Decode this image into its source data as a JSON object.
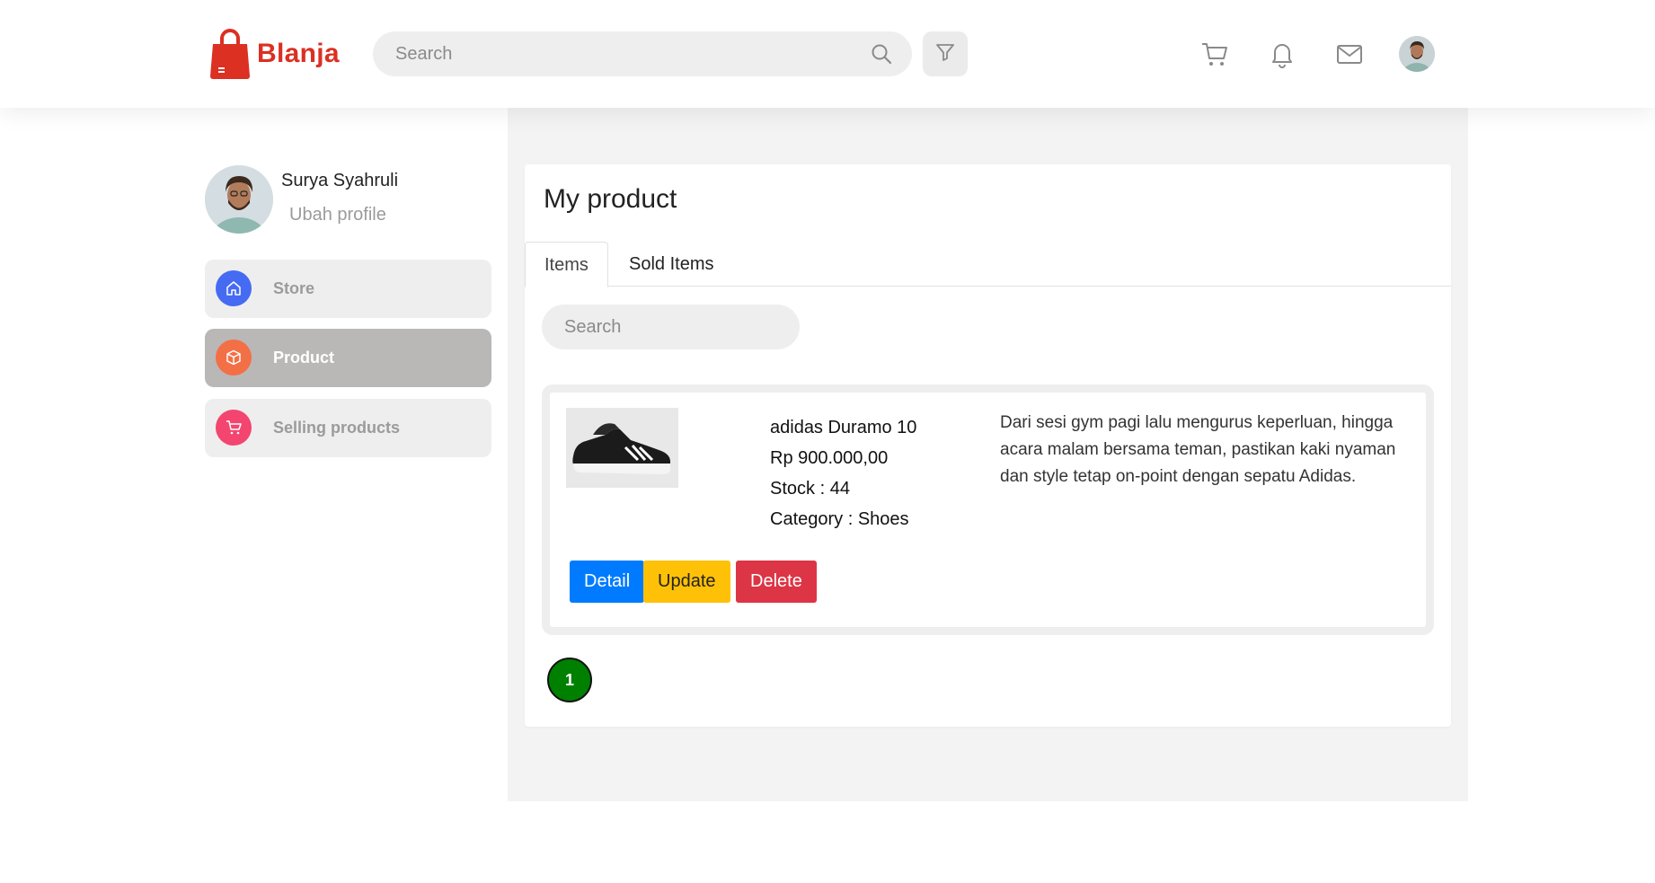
{
  "header": {
    "brand": "Blanja",
    "search_placeholder": "Search",
    "icons": [
      "cart-icon",
      "bell-icon",
      "mail-icon"
    ]
  },
  "sidebar": {
    "user_name": "Surya Syahruli",
    "edit_profile": "Ubah profile",
    "items": [
      {
        "label": "Store",
        "icon": "home-icon",
        "color": "#456bf3",
        "active": false
      },
      {
        "label": "Product",
        "icon": "box-icon",
        "color": "#f36f45",
        "active": true
      },
      {
        "label": "Selling products",
        "icon": "cart-icon",
        "color": "#f3456f",
        "active": false
      }
    ]
  },
  "main": {
    "title": "My product",
    "tabs": [
      {
        "label": "Items",
        "active": true
      },
      {
        "label": "Sold Items",
        "active": false
      }
    ],
    "search_placeholder": "Search",
    "product": {
      "name": "adidas Duramo 10",
      "price": "Rp 900.000,00",
      "stock": "Stock : 44",
      "category": "Category : Shoes",
      "description": "Dari sesi gym pagi lalu mengurus keperluan, hingga acara malam bersama teman, pastikan kaki nyaman dan style tetap on-point dengan sepatu Adidas.",
      "buttons": {
        "detail": "Detail",
        "update": "Update",
        "delete": "Delete"
      }
    },
    "pagination": {
      "current": "1"
    }
  },
  "colors": {
    "brand": "#db3022",
    "detail": "#007bff",
    "update": "#ffc107",
    "delete": "#dc3545",
    "page_badge": "#008000"
  }
}
